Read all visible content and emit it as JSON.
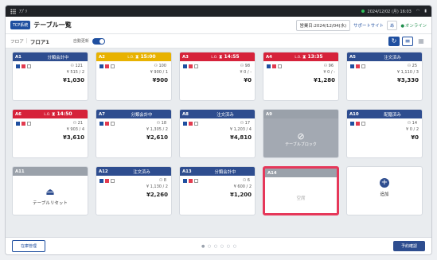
{
  "sysbar": {
    "app": "ｱﾌﾟﾘ",
    "datetime": "2024/12/02 (月) 16:03",
    "wifi": "wifi",
    "batt": "battery"
  },
  "header": {
    "badge": "TCP系統",
    "title": "テーブル一覧",
    "biz_date": "営業日:2024/12/04(水)",
    "support": "サポートサイト",
    "lang": "あ",
    "status": "オンライン"
  },
  "subbar": {
    "floor_label": "フロア",
    "floor_value": "フロア1",
    "auto_label": "自動更新"
  },
  "tables": [
    {
      "id": "A1",
      "status": "分類会計中",
      "color": "blue",
      "guests": "121",
      "line1": "515 / 2",
      "total": "1,030"
    },
    {
      "id": "A2",
      "status": "15:00",
      "color": "yellow",
      "timer": true,
      "guests": "100",
      "line1": "900 / 1",
      "total": "900"
    },
    {
      "id": "A3",
      "status": "14:55",
      "color": "red",
      "timer": true,
      "guests": "98",
      "line1": "0 / -",
      "total": "0"
    },
    {
      "id": "A4",
      "status": "13:35",
      "color": "red",
      "timer": true,
      "guests": "96",
      "line1": "0 / -",
      "total": "1,280"
    },
    {
      "id": "A5",
      "status": "注文済み",
      "color": "blue",
      "guests": "25",
      "line1": "1,110 / 3",
      "total": "3,330"
    },
    {
      "id": "A6",
      "status": "14:50",
      "color": "red",
      "timer": true,
      "guests": "21",
      "line1": "903 / 4",
      "total": "3,610"
    },
    {
      "id": "A7",
      "status": "分類会計中",
      "color": "blue",
      "guests": "18",
      "line1": "1,305 / 2",
      "total": "2,610"
    },
    {
      "id": "A8",
      "status": "注文済み",
      "color": "blue",
      "guests": "17",
      "line1": "1,203 / 4",
      "total": "4,810"
    },
    {
      "id": "A9",
      "status": "",
      "color": "gray",
      "empty_label": "テーブルブロック",
      "type": "blocked"
    },
    {
      "id": "A10",
      "status": "配膳済み",
      "color": "blue",
      "guests": "14",
      "line1": "0 / 2",
      "total": "0"
    },
    {
      "id": "A11",
      "status": "",
      "color": "gray",
      "empty_label": "テーブルリセット",
      "type": "reset"
    },
    {
      "id": "A12",
      "status": "注文済み",
      "color": "blue",
      "guests": "8",
      "line1": "1,130 / 2",
      "total": "2,260"
    },
    {
      "id": "A13",
      "status": "分類会計中",
      "color": "blue",
      "guests": "6",
      "line1": "600 / 2",
      "total": "1,200"
    },
    {
      "id": "A14",
      "status": "",
      "color": "gray",
      "empty_label": "空席",
      "type": "vacant"
    },
    {
      "id": "",
      "status": "",
      "color": "none",
      "empty_label": "追加",
      "type": "add"
    }
  ],
  "footer": {
    "inventory": "在庫管理",
    "reservation": "予約確認"
  },
  "icons": {
    "refresh": "refresh-icon",
    "list": "list-view-icon",
    "grid": "grid-view-icon"
  }
}
